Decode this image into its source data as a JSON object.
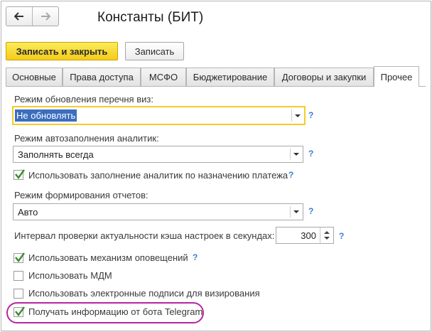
{
  "window": {
    "title": "Константы (БИТ)"
  },
  "toolbar": {
    "save_close_label": "Записать и закрыть",
    "save_label": "Записать"
  },
  "tabs": [
    {
      "label": "Основные"
    },
    {
      "label": "Права доступа"
    },
    {
      "label": "МСФО"
    },
    {
      "label": "Бюджетирование"
    },
    {
      "label": "Договоры и закупки"
    },
    {
      "label": "Прочее"
    }
  ],
  "form": {
    "visa_update_label": "Режим обновления перечня виз:",
    "visa_update_value": "Не обновлять",
    "autofill_label": "Режим автозаполнения аналитик:",
    "autofill_value": "Заполнять всегда",
    "use_autofill_by_purpose_label": "Использовать заполнение аналитик по назначению платежа",
    "use_autofill_by_purpose_checked": true,
    "report_mode_label": "Режим формирования отчетов:",
    "report_mode_value": "Авто",
    "cache_interval_label": "Интервал проверки актуальности кэша настроек в секундах:",
    "cache_interval_value": "300",
    "use_notifications_label": "Использовать механизм оповещений",
    "use_notifications_checked": true,
    "use_mdm_label": "Использовать МДМ",
    "use_mdm_checked": false,
    "use_esign_label": "Использовать электронные подписи для визирования",
    "use_esign_checked": false,
    "telegram_label": "Получать информацию от бота Telegram",
    "telegram_checked": true,
    "help_mark": "?"
  },
  "colors": {
    "accent_button": "#f5d02a",
    "focus_border": "#f2cd29",
    "help": "#3d7bd6",
    "highlight_oval": "#b6279f",
    "check": "#3e8a2f"
  }
}
